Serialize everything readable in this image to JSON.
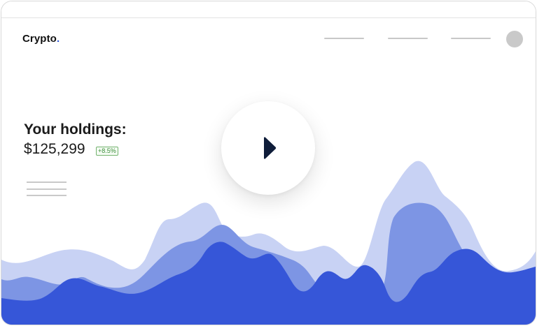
{
  "header": {
    "brand": "Crypto",
    "brand_dot": ".",
    "nav_items": [
      "",
      "",
      ""
    ]
  },
  "holdings": {
    "title": "Your holdings:",
    "amount": "$125,299",
    "change": "+8.5%"
  },
  "icons": {
    "play": "play-icon",
    "avatar": "avatar-circle",
    "menu": "menu-lines-icon"
  },
  "colors": {
    "brand_accent": "#2f57d6",
    "wave_light": "#c8d2f4",
    "wave_mid": "#7d95e4",
    "wave_dark": "#3656d8",
    "badge_green": "#3d8f3b",
    "play_arrow": "#0f1d3a"
  }
}
